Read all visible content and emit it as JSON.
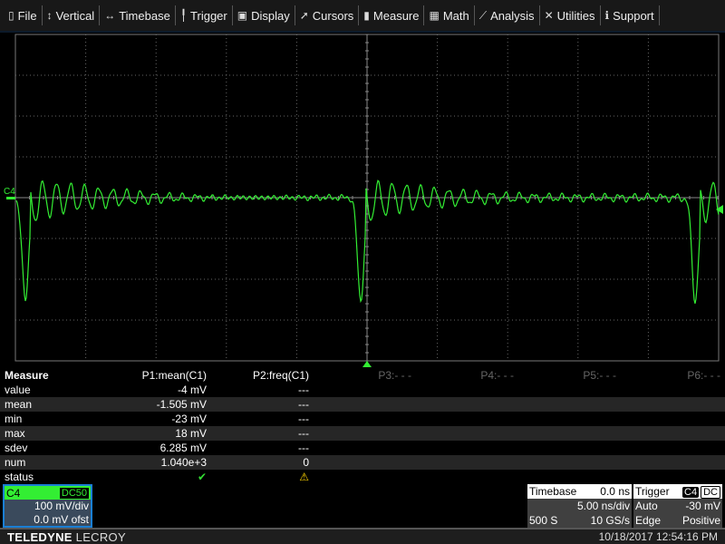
{
  "menu": [
    {
      "label": "File",
      "icon": "file-icon",
      "glyph": "▯"
    },
    {
      "label": "Vertical",
      "icon": "vertical-arrows-icon",
      "glyph": "↕"
    },
    {
      "label": "Timebase",
      "icon": "horizontal-arrows-icon",
      "glyph": "↔"
    },
    {
      "label": "Trigger",
      "icon": "trigger-icon",
      "glyph": "╿"
    },
    {
      "label": "Display",
      "icon": "display-icon",
      "glyph": "▣"
    },
    {
      "label": "Cursors",
      "icon": "cursor-icon",
      "glyph": "➚"
    },
    {
      "label": "Measure",
      "icon": "ruler-icon",
      "glyph": "▮"
    },
    {
      "label": "Math",
      "icon": "calculator-icon",
      "glyph": "▦"
    },
    {
      "label": "Analysis",
      "icon": "chart-icon",
      "glyph": "⟋"
    },
    {
      "label": "Utilities",
      "icon": "tools-icon",
      "glyph": "✕"
    },
    {
      "label": "Support",
      "icon": "info-icon",
      "glyph": "ℹ"
    }
  ],
  "trace": {
    "label": "C4",
    "color": "#33ee33"
  },
  "measure": {
    "title": "Measure",
    "params": [
      "P1:mean(C1)",
      "P2:freq(C1)",
      "P3:- - -",
      "P4:- - -",
      "P5:- - -",
      "P6:- - -"
    ],
    "rows": [
      {
        "label": "value",
        "p1": "-4 mV",
        "p2": "---"
      },
      {
        "label": "mean",
        "p1": "-1.505 mV",
        "p2": "---"
      },
      {
        "label": "min",
        "p1": "-23 mV",
        "p2": "---"
      },
      {
        "label": "max",
        "p1": "18 mV",
        "p2": "---"
      },
      {
        "label": "sdev",
        "p1": "6.285 mV",
        "p2": "---"
      },
      {
        "label": "num",
        "p1": "1.040e+3",
        "p2": "0"
      },
      {
        "label": "status",
        "p1": "✔",
        "p2": "⚠"
      }
    ]
  },
  "channel": {
    "name": "C4",
    "coupling": "DC50",
    "scale": "100 mV/div",
    "offset": "0.0 mV ofst"
  },
  "timebase": {
    "title": "Timebase",
    "delay": "0.0 ns",
    "scale": "5.00 ns/div",
    "samples": "500 S",
    "rate": "10 GS/s"
  },
  "trigger": {
    "title": "Trigger",
    "source": "C4",
    "coupling": "DC",
    "mode": "Auto",
    "level": "-30 mV",
    "type": "Edge",
    "slope": "Positive"
  },
  "footer": {
    "brand_bold": "TELEDYNE",
    "brand": "LECROY",
    "datetime": "10/18/2017 12:54:16 PM"
  }
}
